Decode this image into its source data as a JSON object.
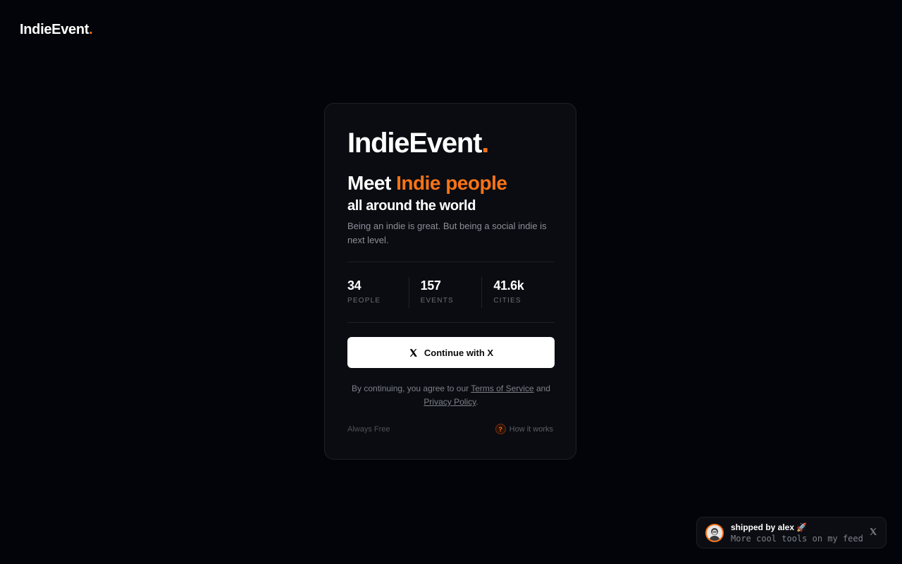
{
  "header": {
    "brand_text": "IndieEvent",
    "brand_dot": "."
  },
  "card": {
    "logo_text": "IndieEvent",
    "logo_dot": ".",
    "headline_prefix": "Meet",
    "headline_accent": "Indie people",
    "subheadline": "all around the world",
    "description": "Being an indie is great. But being a social indie is next level.",
    "stats": [
      {
        "value": "34",
        "label": "PEOPLE"
      },
      {
        "value": "157",
        "label": "EVENTS"
      },
      {
        "value": "41.6k",
        "label": "CITIES"
      }
    ],
    "button_label": "Continue with X",
    "button_icon": "x-logo-icon",
    "legal_prefix": "By continuing, you agree to our",
    "terms_link": "Terms of Service",
    "legal_and": "and",
    "privacy_link": "Privacy Policy",
    "legal_suffix": ".",
    "footer_left": "Always Free",
    "footer_right": "How it works",
    "footer_right_icon": "?"
  },
  "toast": {
    "title": "shipped by alex 🚀",
    "subtitle": "More cool tools on my feed",
    "close_icon": "x-logo-icon"
  },
  "colors": {
    "background": "#030409",
    "card_background": "#0a0c11",
    "accent": "#f97316",
    "button_background": "#ffffff"
  }
}
